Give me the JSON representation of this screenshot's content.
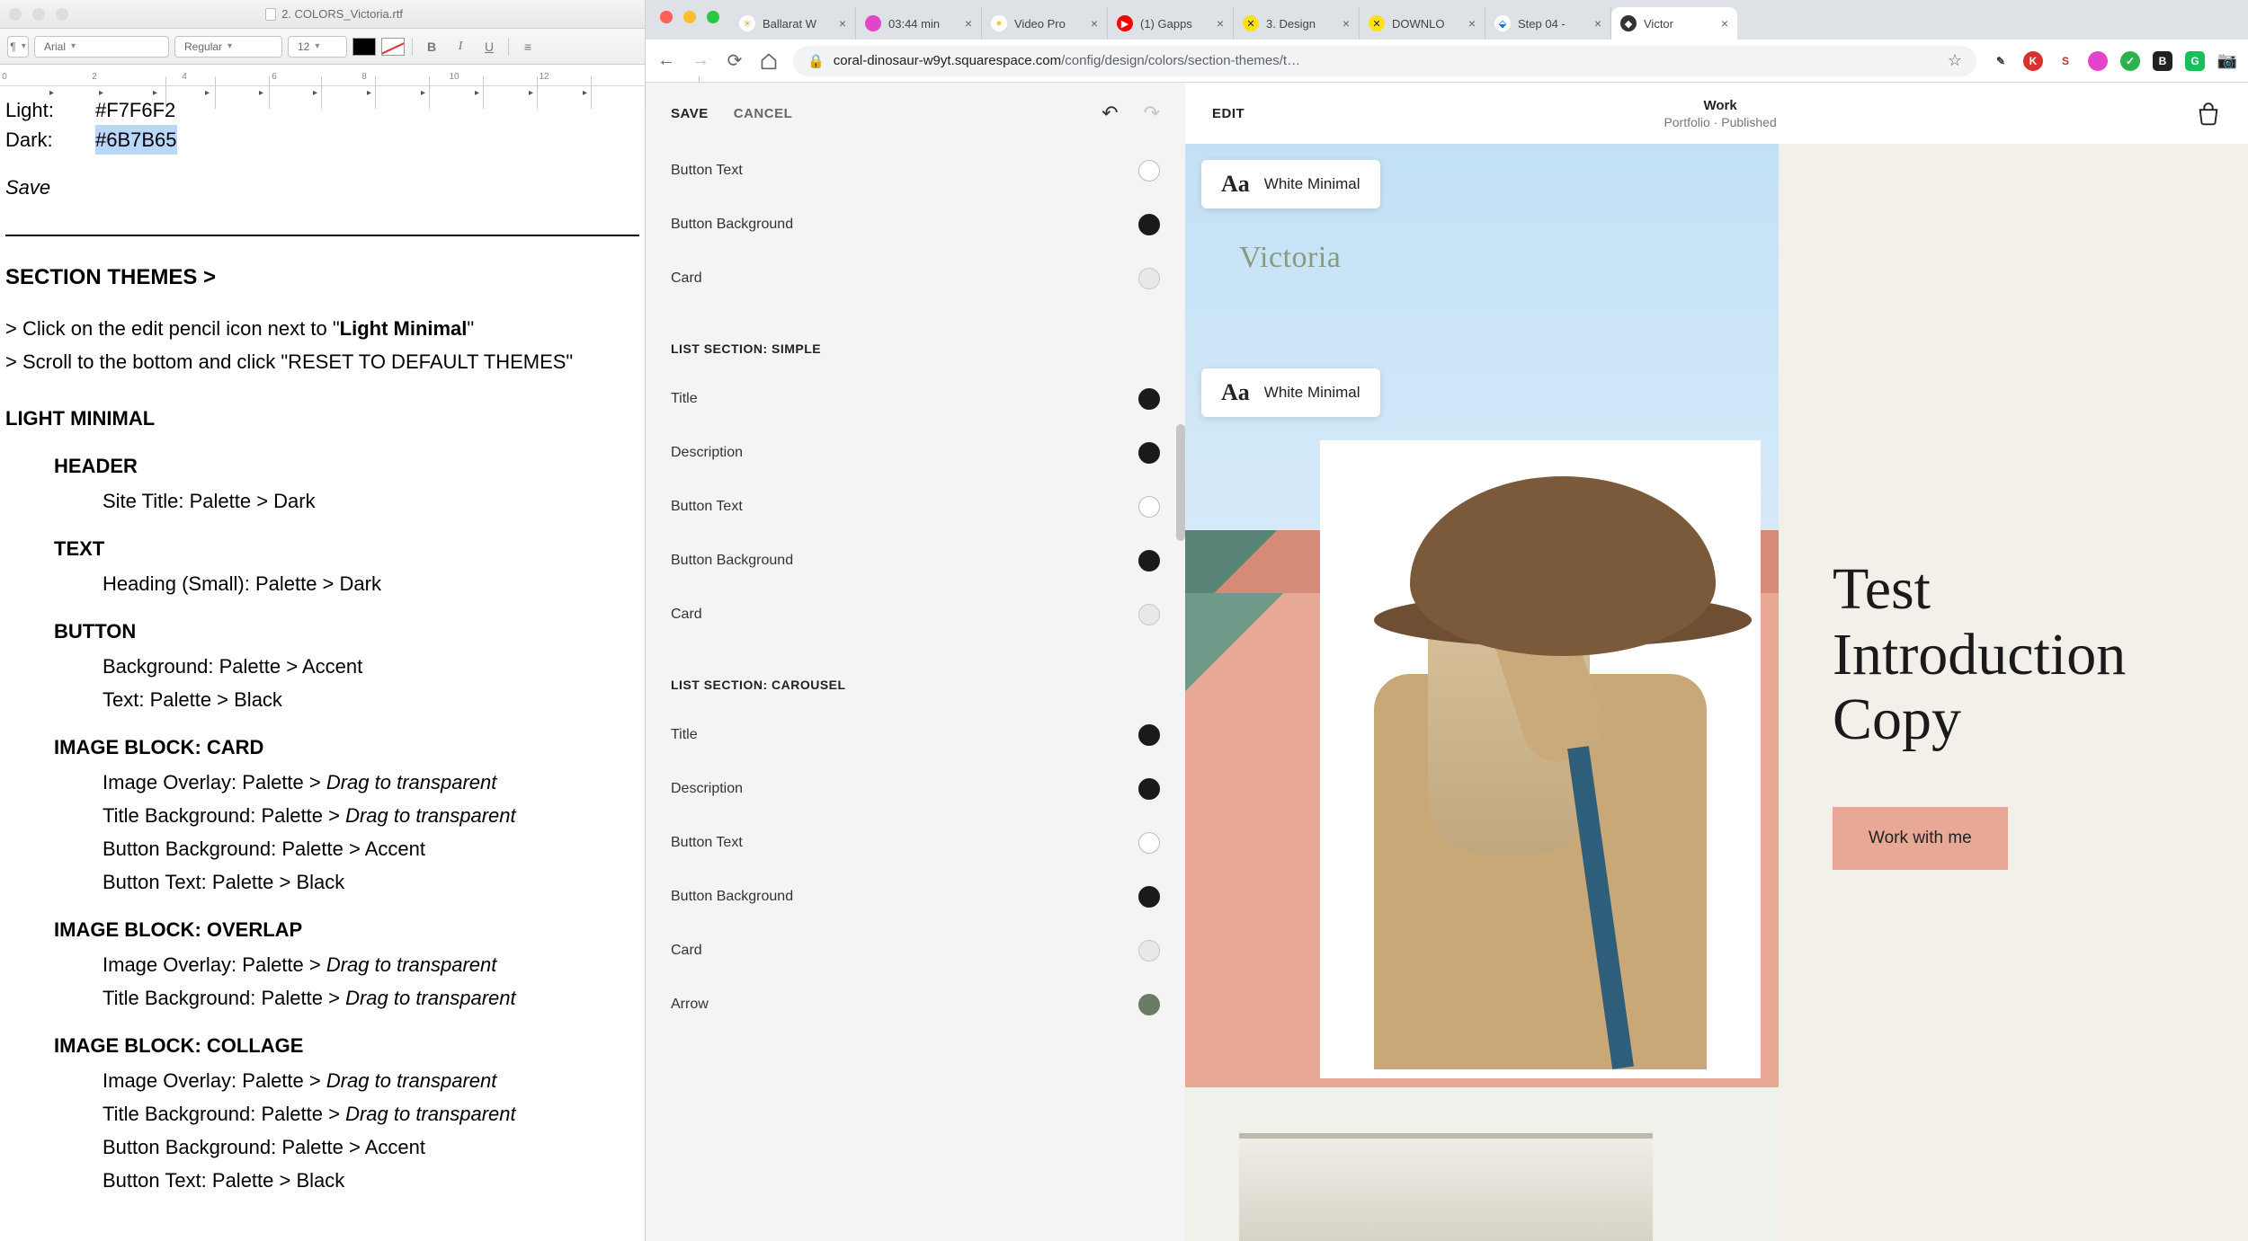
{
  "textedit": {
    "title": "2. COLORS_Victoria.rtf",
    "font_family": "Arial",
    "font_style": "Regular",
    "font_size": "12",
    "light_label": "Light:",
    "light_value": "#F7F6F2",
    "dark_label": "Dark:",
    "dark_value": "#6B7B65",
    "save_note": "Save",
    "section_themes_heading": "SECTION THEMES >",
    "instr1_a": "> Click on the edit pencil icon next to \"",
    "instr1_b": "Light Minimal",
    "instr1_c": "\"",
    "instr2": "> Scroll to the bottom and click \"RESET TO DEFAULT THEMES\"",
    "h_light_minimal": "LIGHT MINIMAL",
    "h_header": "HEADER",
    "header_line": "Site Title: Palette > Dark",
    "h_text": "TEXT",
    "text_line": "Heading (Small): Palette > Dark",
    "h_button": "BUTTON",
    "button_l1": "Background: Palette > Accent",
    "button_l2": "Text: Palette > Black",
    "h_imgcard": "IMAGE BLOCK: CARD",
    "card_l1_a": "Image Overlay: Palette > ",
    "card_l1_b": "Drag to transparent",
    "card_l2_a": "Title Background: Palette > ",
    "card_l2_b": "Drag to transparent",
    "card_l3": "Button Background: Palette > Accent",
    "card_l4": "Button Text: Palette > Black",
    "h_imgoverlap": "IMAGE BLOCK: OVERLAP",
    "over_l1_a": "Image Overlay: Palette > ",
    "over_l1_b": "Drag to transparent",
    "over_l2_a": "Title Background: Palette > ",
    "over_l2_b": "Drag to transparent",
    "h_imgcollage": "IMAGE BLOCK: COLLAGE",
    "col_l1_a": "Image Overlay: Palette > ",
    "col_l1_b": "Drag to transparent",
    "col_l2_a": "Title Background: Palette > ",
    "col_l2_b": "Drag to transparent",
    "col_l3": "Button Background: Palette > Accent",
    "col_l4": "Button Text: Palette > Black"
  },
  "chrome": {
    "tabs": [
      {
        "label": "Ballarat W",
        "fav_bg": "#fff",
        "fav_txt": "✳",
        "fav_color": "#c9b24a"
      },
      {
        "label": "03:44 min",
        "fav_bg": "#e444c9",
        "fav_txt": "",
        "fav_color": "#fff"
      },
      {
        "label": "Video Pro",
        "fav_bg": "#fff",
        "fav_txt": "●",
        "fav_color": "#f2c94a"
      },
      {
        "label": "(1) Gapps",
        "fav_bg": "#ff0000",
        "fav_txt": "▶",
        "fav_color": "#fff"
      },
      {
        "label": "3. Design",
        "fav_bg": "#ffe015",
        "fav_txt": "✕",
        "fav_color": "#222"
      },
      {
        "label": "DOWNLO",
        "fav_bg": "#ffe015",
        "fav_txt": "✕",
        "fav_color": "#222"
      },
      {
        "label": "Step 04 -",
        "fav_bg": "#fff",
        "fav_txt": "⬙",
        "fav_color": "#0061ff"
      },
      {
        "label": "Victor",
        "fav_bg": "#333",
        "fav_txt": "◆",
        "fav_color": "#fff",
        "active": true
      }
    ],
    "url_host": "coral-dinosaur-w9yt.squarespace.com",
    "url_path": "/config/design/colors/section-themes/t…"
  },
  "sqs": {
    "save": "SAVE",
    "cancel": "CANCEL",
    "groups": [
      {
        "title": null,
        "items": [
          {
            "label": "Button Text",
            "swatch": "sw-white"
          },
          {
            "label": "Button Background",
            "swatch": "sw-black"
          },
          {
            "label": "Card",
            "swatch": "sw-grey"
          }
        ]
      },
      {
        "title": "LIST SECTION: SIMPLE",
        "items": [
          {
            "label": "Title",
            "swatch": "sw-black"
          },
          {
            "label": "Description",
            "swatch": "sw-black"
          },
          {
            "label": "Button Text",
            "swatch": "sw-white"
          },
          {
            "label": "Button Background",
            "swatch": "sw-black"
          },
          {
            "label": "Card",
            "swatch": "sw-grey"
          }
        ]
      },
      {
        "title": "LIST SECTION: CAROUSEL",
        "items": [
          {
            "label": "Title",
            "swatch": "sw-black"
          },
          {
            "label": "Description",
            "swatch": "sw-black"
          },
          {
            "label": "Button Text",
            "swatch": "sw-white"
          },
          {
            "label": "Button Background",
            "swatch": "sw-black"
          },
          {
            "label": "Card",
            "swatch": "sw-grey"
          },
          {
            "label": "Arrow",
            "swatch": "sw-olive"
          }
        ]
      }
    ]
  },
  "preview": {
    "edit": "EDIT",
    "title": "Work",
    "subtitle": "Portfolio · Published",
    "badge1": "White Minimal",
    "badge2": "White Minimal",
    "brand": "Victoria",
    "headline": "Test Introduction Copy",
    "cta": "Work with me"
  }
}
